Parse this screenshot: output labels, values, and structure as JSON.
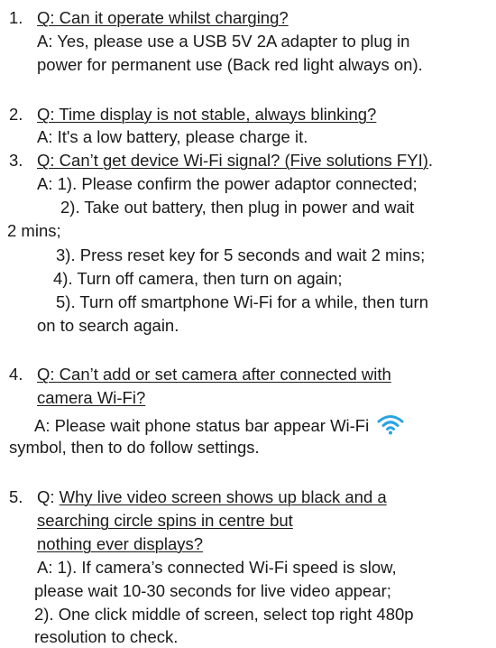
{
  "faq": {
    "q1": {
      "num": "1.",
      "question": "Q: Can it operate whilst charging?",
      "answer": [
        "A: Yes, please use a USB 5V 2A adapter to plug in",
        "power for permanent use (Back red light always on)."
      ]
    },
    "q2": {
      "num": "2.",
      "question": "Q: Time display is not stable, always blinking?",
      "answer": [
        "A: It's a low battery, please charge it."
      ]
    },
    "q3": {
      "num": "3.",
      "question": "Q: Can’t get device Wi-Fi signal? (Five solutions FYI)",
      "after_question": ".",
      "answer": [
        "A: 1). Please confirm the power adaptor connected;",
        "2). Take out battery, then plug in power and wait",
        "2 mins;",
        "3). Press reset key for 5 seconds and wait 2 mins;",
        "4). Turn off camera, then turn on again;",
        "5). Turn off smartphone Wi-Fi for a while, then turn",
        "on to search again."
      ]
    },
    "q4": {
      "num": "4.",
      "question_lines": [
        "Q: Can’t add or set camera after connected with",
        "camera Wi-Fi?"
      ],
      "answer": [
        "A: Please wait phone status bar appear Wi-Fi",
        "symbol, then to do follow settings."
      ],
      "icon": "wifi-icon",
      "icon_color": "#2aa3e0"
    },
    "q5": {
      "num": "5.",
      "q_prefix": "Q:",
      "question_lines": [
        "Why live video screen shows up black and a",
        "searching circle spins in centre but",
        "nothing ever displays?"
      ],
      "answer": [
        "A: 1). If camera’s connected Wi-Fi speed is slow,",
        "please wait 10-30 seconds for live video appear;",
        "2). One click middle of screen, select top right 480p",
        "resolution to check."
      ]
    }
  }
}
